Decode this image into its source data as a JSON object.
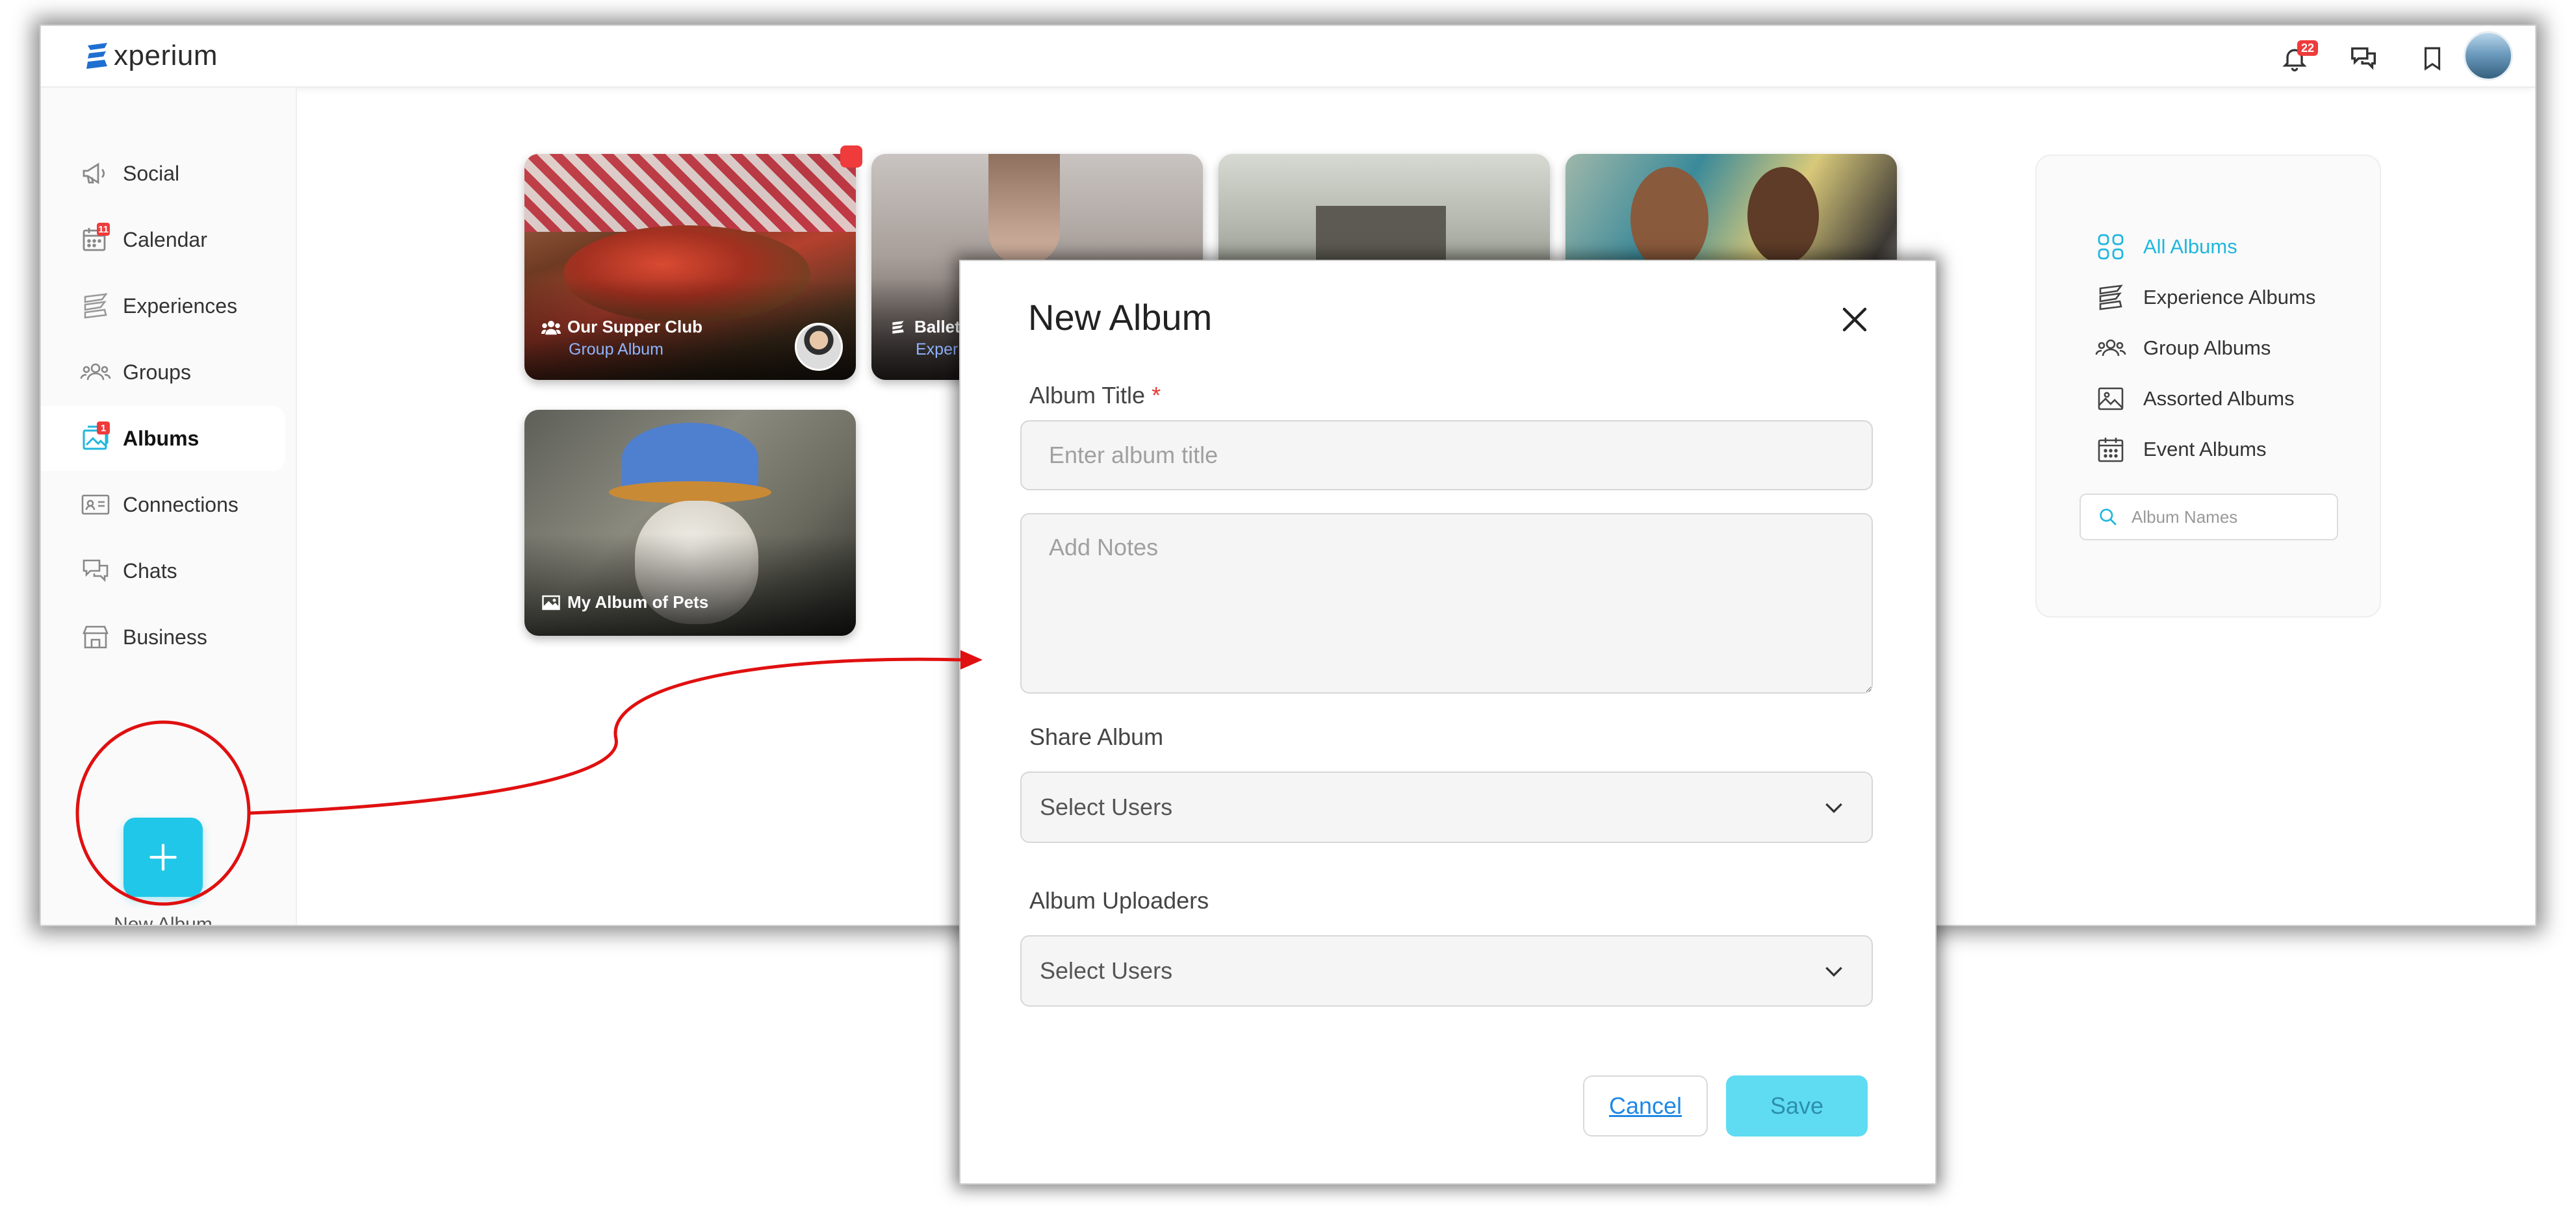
{
  "app": {
    "logo_text": "xperium",
    "notification_count": "22"
  },
  "sidebar": {
    "items": [
      {
        "label": "Social",
        "icon": "megaphone-icon"
      },
      {
        "label": "Calendar",
        "icon": "calendar-icon",
        "badge": "11"
      },
      {
        "label": "Experiences",
        "icon": "experium-logo-icon"
      },
      {
        "label": "Groups",
        "icon": "groups-icon"
      },
      {
        "label": "Albums",
        "icon": "albums-icon",
        "badge": "1",
        "active": true
      },
      {
        "label": "Connections",
        "icon": "contact-card-icon"
      },
      {
        "label": "Chats",
        "icon": "chat-bubbles-icon"
      },
      {
        "label": "Business",
        "icon": "storefront-icon"
      }
    ],
    "new_album_label": "New Album"
  },
  "albums": [
    {
      "title": "Our Supper Club",
      "subtitle": "Group Album",
      "icon": "group-icon"
    },
    {
      "title": "Ballet",
      "subtitle": "Exper",
      "icon": "experium-logo-icon"
    },
    {
      "title": "",
      "subtitle": "",
      "icon": ""
    },
    {
      "title": "",
      "subtitle": "",
      "icon": ""
    },
    {
      "title": "My Album of Pets",
      "subtitle": "",
      "icon": "image-icon"
    }
  ],
  "filters": {
    "items": [
      {
        "label": "All Albums",
        "icon": "grid-icon",
        "active": true
      },
      {
        "label": "Experience Albums",
        "icon": "experium-logo-icon"
      },
      {
        "label": "Group Albums",
        "icon": "groups-icon"
      },
      {
        "label": "Assorted Albums",
        "icon": "image-icon"
      },
      {
        "label": "Event Albums",
        "icon": "calendar-icon"
      }
    ],
    "search_placeholder": "Album Names"
  },
  "modal": {
    "title": "New Album",
    "album_title_label": "Album Title",
    "required_mark": "*",
    "album_title_placeholder": "Enter album title",
    "notes_placeholder": "Add Notes",
    "share_label": "Share Album",
    "share_select_value": "Select Users",
    "uploaders_label": "Album Uploaders",
    "uploaders_select_value": "Select Users",
    "cancel_label": "Cancel",
    "save_label": "Save"
  },
  "colors": {
    "accent": "#21c7e8",
    "annotation": "#e01010",
    "badge": "#ef3b3b"
  }
}
